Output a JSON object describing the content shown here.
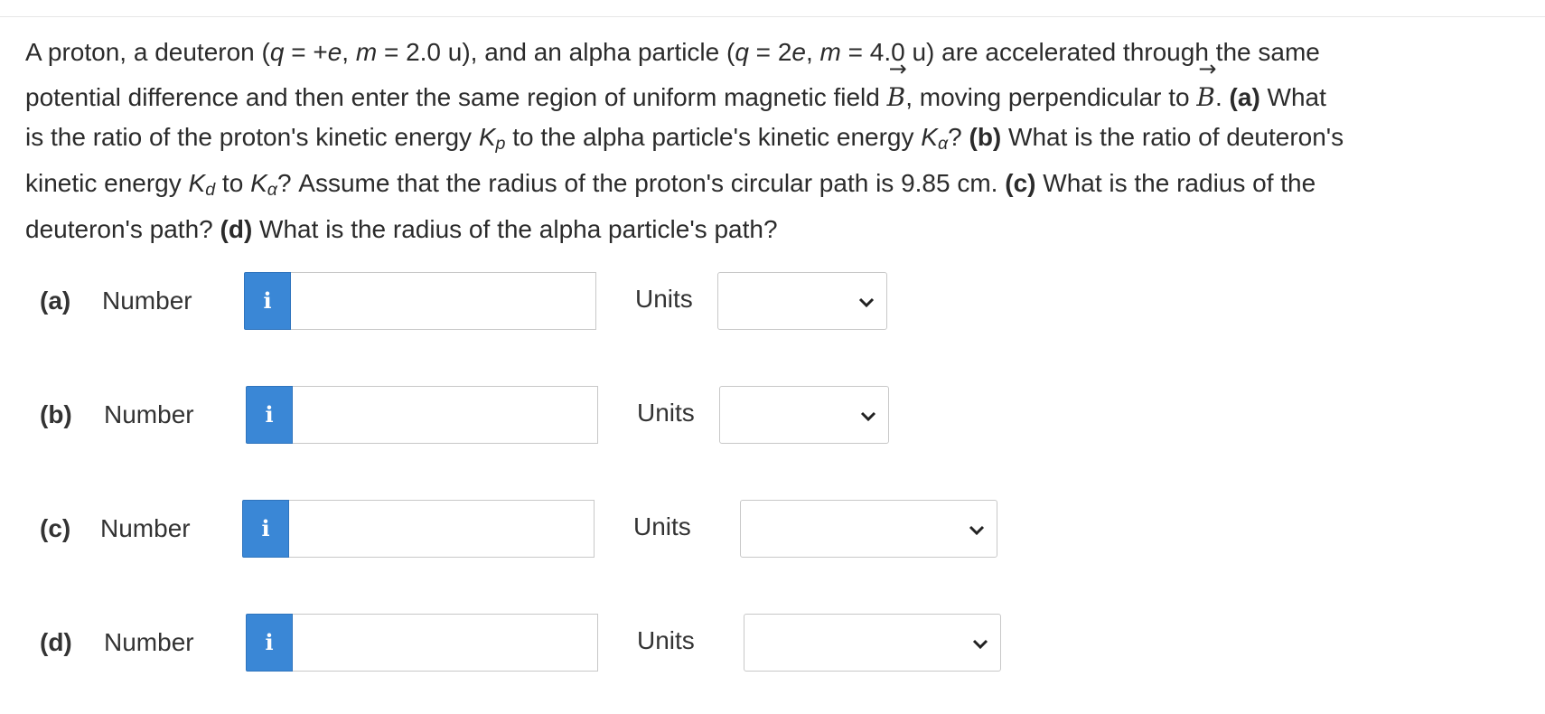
{
  "question": {
    "line1": {
      "a": "A proton, a deuteron (",
      "q1": "q",
      "b": " = +",
      "e1": "e",
      "c": ", ",
      "m1": "m",
      "d": " = 2.0 u), and an alpha particle (",
      "q2": "q",
      "e": " = 2",
      "e2": "e",
      "f": ", ",
      "m2": "m",
      "g": " = 4.0 u) are accelerated through the same"
    },
    "line2": {
      "a": "potential difference and then enter the same region of uniform magnetic field ",
      "B1": "B",
      "arrow": "→",
      "b": ", moving perpendicular to ",
      "B2": "B",
      "c": ". ",
      "pa": "(a)",
      "d": " What"
    },
    "line3": {
      "a": "is the ratio of the proton's kinetic energy ",
      "Kp": "K",
      "p": "p",
      "b": " to the alpha particle's kinetic energy ",
      "Ka": "K",
      "alpha": "α",
      "c": "? ",
      "pb": "(b)",
      "d": " What is the ratio of deuteron's"
    },
    "line4": {
      "a": "kinetic energy ",
      "Kd": "K",
      "d_sub": "d",
      "b": " to ",
      "Ka": "K",
      "alpha": "α",
      "c": "? Assume that the radius of the proton's circular path is 9.85 cm. ",
      "pc": "(c)",
      "d": " What is the radius of the"
    },
    "line5": {
      "a": "deuteron's path? ",
      "pd": "(d)",
      "b": " What is the radius of the alpha particle's path?"
    }
  },
  "answers": [
    {
      "part": "(a)",
      "number_label": "Number",
      "info": "i",
      "value": "",
      "units_label": "Units",
      "units_value": ""
    },
    {
      "part": "(b)",
      "number_label": "Number",
      "info": "i",
      "value": "",
      "units_label": "Units",
      "units_value": ""
    },
    {
      "part": "(c)",
      "number_label": "Number",
      "info": "i",
      "value": "",
      "units_label": "Units",
      "units_value": ""
    },
    {
      "part": "(d)",
      "number_label": "Number",
      "info": "i",
      "value": "",
      "units_label": "Units",
      "units_value": ""
    }
  ],
  "colors": {
    "info_button": "#3a87d6",
    "text": "#2b2b2b",
    "border": "#c8c8c8"
  },
  "icons": {
    "info": "info-icon",
    "dropdown": "chevron-down-icon"
  }
}
